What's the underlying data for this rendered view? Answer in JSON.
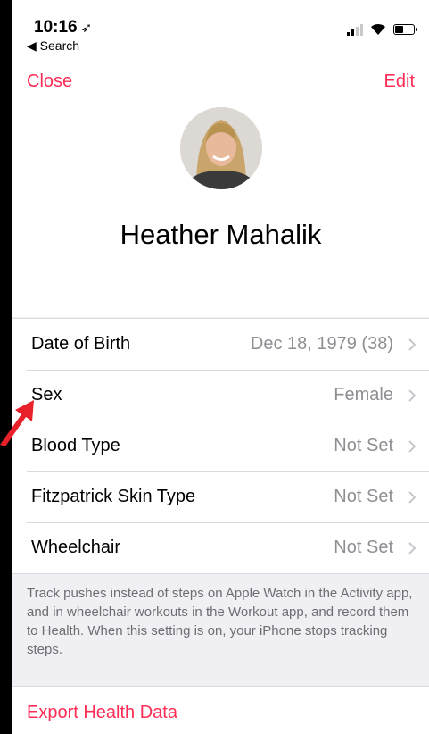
{
  "status_bar": {
    "time": "10:16",
    "location_icon": "location-arrow-icon",
    "back_label": "◀ Search"
  },
  "nav": {
    "close_label": "Close",
    "edit_label": "Edit"
  },
  "profile": {
    "name": "Heather Mahalik"
  },
  "rows": [
    {
      "label": "Date of Birth",
      "value": "Dec 18, 1979 (38)"
    },
    {
      "label": "Sex",
      "value": "Female"
    },
    {
      "label": "Blood Type",
      "value": "Not Set"
    },
    {
      "label": "Fitzpatrick Skin Type",
      "value": "Not Set"
    },
    {
      "label": "Wheelchair",
      "value": "Not Set"
    }
  ],
  "footer_note": "Track pushes instead of steps on Apple Watch in the Activity app, and in wheelchair workouts in the Workout app, and record them to Health. When this setting is on, your iPhone stops tracking steps.",
  "export": {
    "label": "Export Health Data"
  },
  "colors": {
    "accent": "#ff2d55",
    "secondary_text": "#8e8e93",
    "background": "#efeff4",
    "annotation_arrow": "#e8202a"
  }
}
